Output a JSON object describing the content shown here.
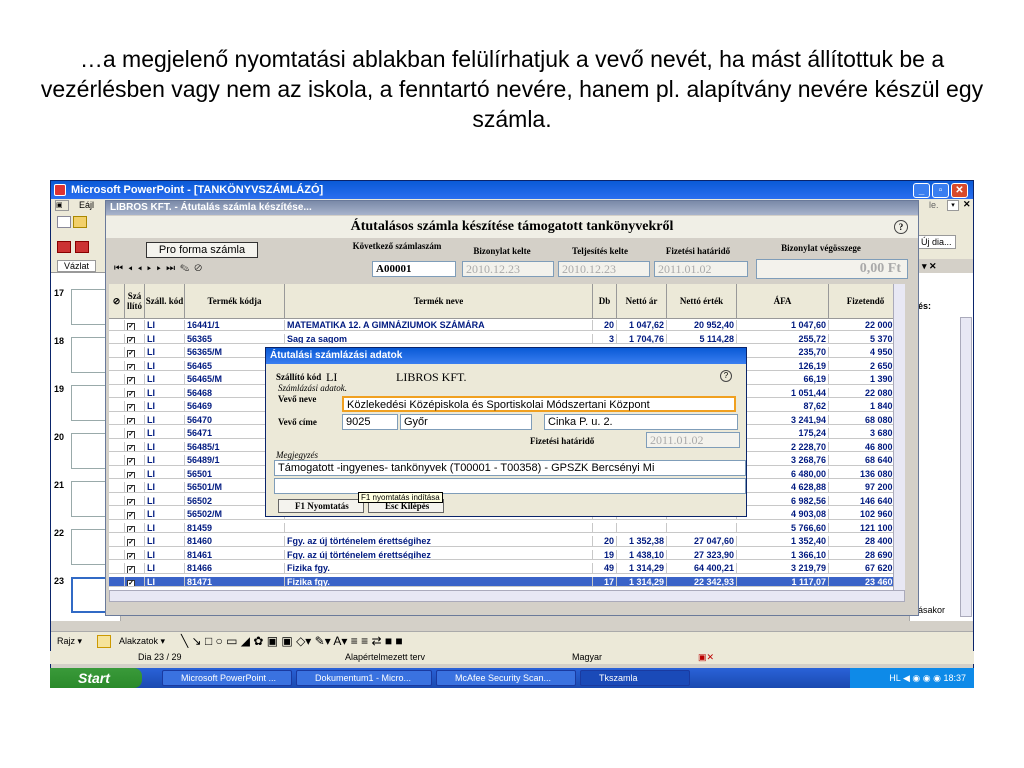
{
  "caption": "…a megjelenő nyomtatási ablakban felülírhatjuk a vevő nevét, ha mást állítottuk be a vezérlésben vagy nem az iskola, a fenntartó nevére, hanem pl. alapítvány nevére készül egy számla.",
  "ppt": {
    "title": "Microsoft PowerPoint - [TANKÖNYVSZÁMLÁZÓ]",
    "menu_partial": "Eájl",
    "vazlat": "Vázlat",
    "right_partial1": "Új dia...",
    "right_partial2": "és:",
    "right_partial3": "ásakor",
    "right_partial4": "le.",
    "slide_numbers": [
      "17",
      "18",
      "19",
      "20",
      "21",
      "22",
      "23"
    ],
    "draw_toolbar": {
      "rajz": "Rajz ▾",
      "alakzatok": "Alakzatok ▾"
    },
    "status": {
      "slide": "Dia 23 / 29",
      "template": "Alapértelmezett terv",
      "lang": "Magyar"
    }
  },
  "app": {
    "title": "LIBROS KFT. - Átutalás számla készítése...",
    "main_title": "Átutalásos számla készítése támogatott tankönyvekről",
    "pro_forma": "Pro forma számla",
    "labels": {
      "kovetkezo": "Következő számlaszám",
      "kelte": "Bizonylat kelte",
      "teljesites": "Teljesítés kelte",
      "fizhat": "Fizetési határidő",
      "vegosszeg": "Bizonylat végösszege"
    },
    "values": {
      "szamlaszam": "A00001",
      "kelte": "2010.12.23",
      "teljesites": "2010.12.23",
      "fizhat": "2011.01.02",
      "vegosszeg": "0,00 Ft"
    },
    "help": "?"
  },
  "table": {
    "headers": [
      "Szá llító",
      "Száll. kód",
      "Termék kódja",
      "Termék neve",
      "Db",
      "Nettó ár",
      "Nettó érték",
      "ÁFA",
      "Fizetendő"
    ],
    "rows": [
      [
        "LI",
        "16441/1",
        "MATEMATIKA 12. A GIMNÁZIUMOK SZÁMÁRA",
        "20",
        "1 047,62",
        "20 952,40",
        "1 047,60",
        "22 000,0"
      ],
      [
        "LI",
        "56365",
        "Sag za sagom",
        "3",
        "1 704,76",
        "5 114,28",
        "255,72",
        "5 370,0"
      ],
      [
        "LI",
        "56365/M",
        "",
        "",
        "",
        "",
        "235,70",
        "4 950,0"
      ],
      [
        "LI",
        "56465",
        "",
        "",
        "",
        "",
        "126,19",
        "2 650,0"
      ],
      [
        "LI",
        "56465/M",
        "",
        "",
        "",
        "",
        "66,19",
        "1 390,0"
      ],
      [
        "LI",
        "56468",
        "",
        "",
        "",
        "",
        "1 051,44",
        "22 080,0"
      ],
      [
        "LI",
        "56469",
        "",
        "",
        "",
        "",
        "87,62",
        "1 840,0"
      ],
      [
        "LI",
        "56470",
        "",
        "",
        "",
        "",
        "3 241,94",
        "68 080,0"
      ],
      [
        "LI",
        "56471",
        "",
        "",
        "",
        "",
        "175,24",
        "3 680,0"
      ],
      [
        "LI",
        "56485/1",
        "",
        "",
        "",
        "",
        "2 228,70",
        "46 800,0"
      ],
      [
        "LI",
        "56489/1",
        "",
        "",
        "",
        "",
        "3 268,76",
        "68 640,0"
      ],
      [
        "LI",
        "56501",
        "",
        "",
        "",
        "",
        "6 480,00",
        "136 080,0"
      ],
      [
        "LI",
        "56501/M",
        "",
        "",
        "",
        "",
        "4 628,88",
        "97 200,0"
      ],
      [
        "LI",
        "56502",
        "",
        "",
        "",
        "",
        "6 982,56",
        "146 640,0"
      ],
      [
        "LI",
        "56502/M",
        "",
        "",
        "",
        "",
        "4 903,08",
        "102 960,0"
      ],
      [
        "LI",
        "81459",
        "",
        "",
        "",
        "",
        "5 766,60",
        "121 100,0"
      ],
      [
        "LI",
        "81460",
        "Fgy. az új történelem érettségihez",
        "20",
        "1 352,38",
        "27 047,60",
        "1 352,40",
        "28 400,0"
      ],
      [
        "LI",
        "81461",
        "Fgy. az új történelem érettségihez",
        "19",
        "1 438,10",
        "27 323,90",
        "1 366,10",
        "28 690,0"
      ],
      [
        "LI",
        "81466",
        "Fizika fgy.",
        "49",
        "1 314,29",
        "64 400,21",
        "3 219,79",
        "67 620,0"
      ],
      [
        "LI",
        "81471",
        "Fizika fgy.",
        "17",
        "1 314,29",
        "22 342,93",
        "1 117,07",
        "23 460,0"
      ]
    ]
  },
  "dialog": {
    "title": "Átutalási számlázási adatok",
    "szallito_kod_label": "Szállító kód",
    "szallito_kod": "LI",
    "szallito_nev": "LIBROS KFT.",
    "szamlazasi": "Számlázási adatok.",
    "vevo_neve_label": "Vevő neve",
    "vevo_neve": "Közlekedési Középiskola és Sportiskolai Módszertani Központ",
    "vevo_cime_label": "Vevő címe",
    "irsz": "9025",
    "varos": "Győr",
    "utca": "Cinka P. u. 2.",
    "fizhat_label": "Fizetési határidő",
    "fizhat": "2011.01.02",
    "megjegyzes_label": "Megjegyzés",
    "megjegyzes": "Támogatott -ingyenes- tankönyvek (T00001 - T00358) - GPSZK Bercsényi Mi",
    "btn_print": "F1 Nyomtatás",
    "btn_exit": "Esc Kilépés",
    "tooltip": "F1 nyomtatás indítása"
  },
  "taskbar": {
    "start": "Start",
    "items": [
      "Microsoft PowerPoint ...",
      "Dokumentum1 - Micro...",
      "McAfee Security Scan...",
      "Tkszamla"
    ],
    "lang": "HL",
    "time": "18:37"
  }
}
